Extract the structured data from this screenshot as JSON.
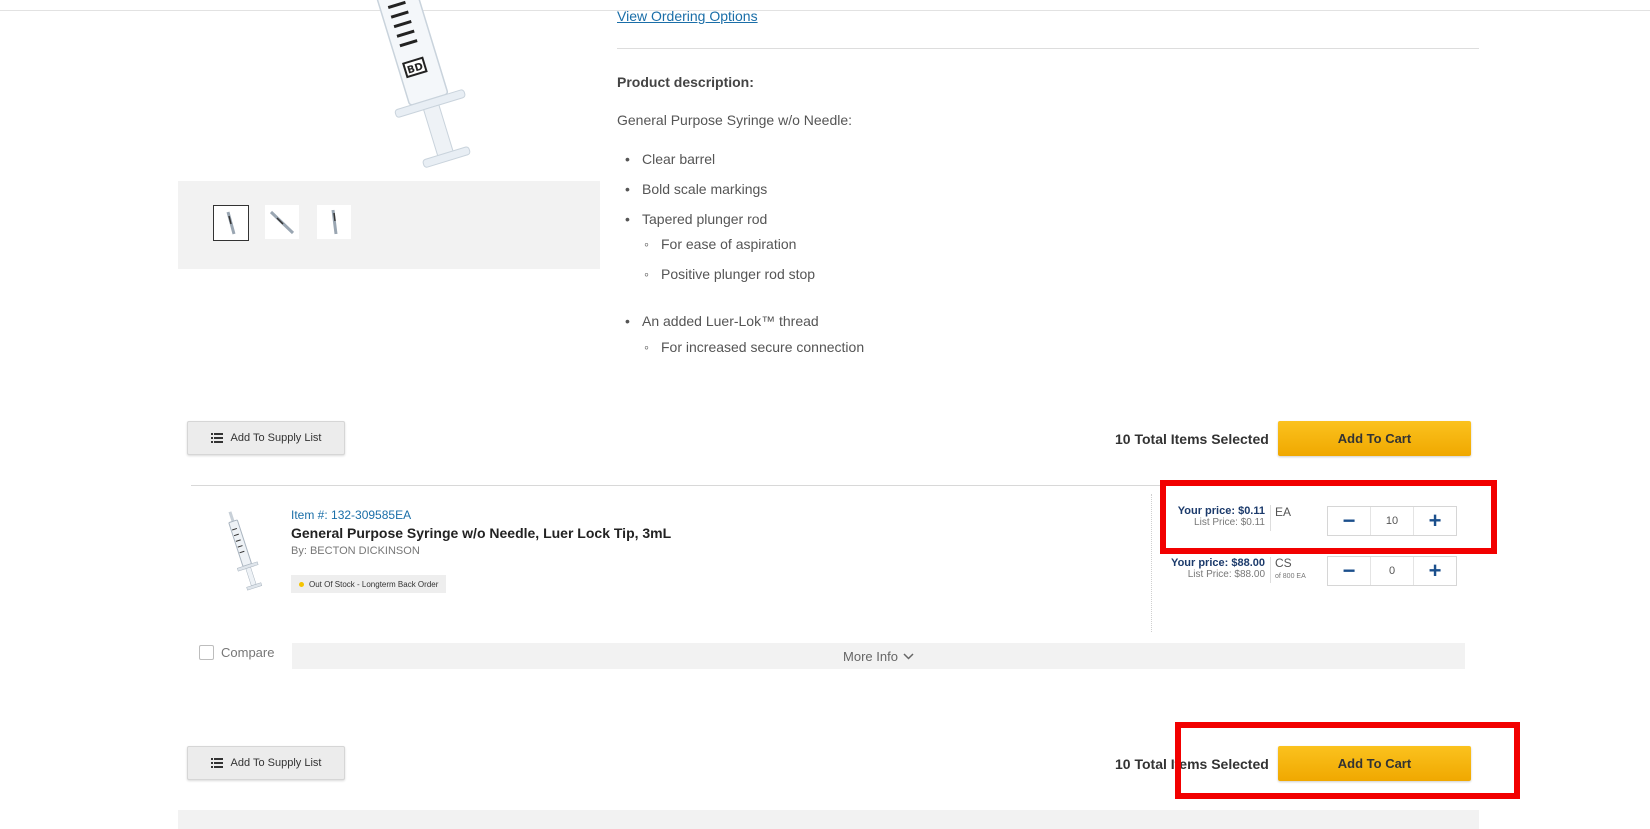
{
  "colors": {
    "link": "#1a6ea8",
    "cart_button": "#f7b710",
    "price_text": "#1b3a6b",
    "stepper_icons": "#1b4f8c",
    "highlight": "#f20000",
    "stock_dot": "#f5c400"
  },
  "gallery": {
    "thumbnails": [
      "syringe-front",
      "syringe-angled",
      "syringe-side"
    ],
    "selected_index": 0
  },
  "description": {
    "view_link": "View Ordering Options",
    "heading": "Product description:",
    "intro": "General Purpose Syringe w/o Needle:",
    "bullets": [
      {
        "text": "Clear barrel"
      },
      {
        "text": "Bold scale markings"
      },
      {
        "text": "Tapered plunger rod",
        "sub": [
          "For ease of aspiration",
          "Positive plunger rod stop"
        ]
      },
      {
        "text": "An added Luer-Lok™ thread",
        "sub": [
          "For increased secure connection"
        ]
      }
    ]
  },
  "action_bar_top": {
    "supply_label": "Add To Supply List",
    "total_text": "10 Total Items Selected",
    "cart_label": "Add To Cart"
  },
  "product": {
    "item_number": "Item #: 132-309585EA",
    "title": "General Purpose Syringe w/o Needle, Luer Lock Tip, 3mL",
    "by": "By: BECTON DICKINSON",
    "stock_status": "Out Of Stock - Longterm Back Order",
    "prices": [
      {
        "your_price": "Your price:  $0.11",
        "list_price": "List Price: $0.11",
        "uom": "EA",
        "uom_sub": "",
        "quantity": "10"
      },
      {
        "your_price": "Your price:  $88.00",
        "list_price": "List Price: $88.00",
        "uom": "CS",
        "uom_sub": "of 800 EA",
        "quantity": "0"
      }
    ],
    "stepper_minus": "−",
    "stepper_plus": "+",
    "compare_label": "Compare",
    "more_info": "More Info"
  },
  "action_bar_bottom": {
    "supply_label": "Add To Supply List",
    "total_text": "10 Total Items Selected",
    "cart_label": "Add To Cart"
  }
}
